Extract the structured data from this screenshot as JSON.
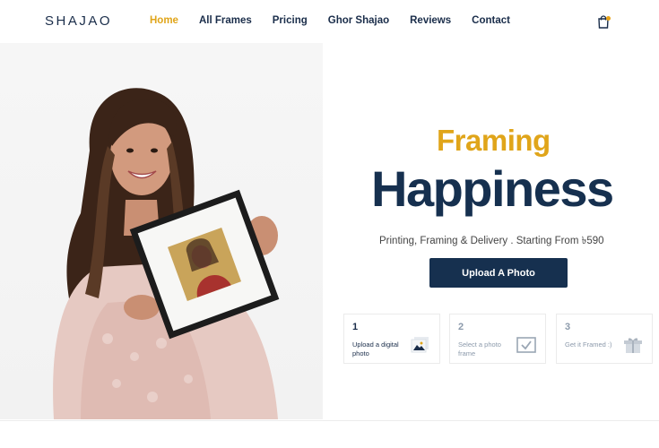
{
  "brand": {
    "logo": "SHAJAO"
  },
  "nav": {
    "items": [
      {
        "label": "Home",
        "active": true
      },
      {
        "label": "All Frames",
        "active": false
      },
      {
        "label": "Pricing",
        "active": false
      },
      {
        "label": "Ghor Shajao",
        "active": false
      },
      {
        "label": "Reviews",
        "active": false
      },
      {
        "label": "Contact",
        "active": false
      }
    ],
    "cart_icon": "shopping-bag-icon"
  },
  "hero": {
    "title_accent": "Framing",
    "title_main": "Happiness",
    "subtitle": "Printing, Framing & Delivery . Starting From ৳590",
    "cta_label": "Upload A Photo",
    "image": "woman-holding-framed-photo"
  },
  "steps": [
    {
      "number": "1",
      "text": "Upload a digital photo",
      "icon": "photo-upload-icon"
    },
    {
      "number": "2",
      "text": "Select a photo frame",
      "icon": "frame-check-icon"
    },
    {
      "number": "3",
      "text": "Get it Framed :)",
      "icon": "gift-box-icon"
    }
  ],
  "colors": {
    "accent": "#e0a51a",
    "navy": "#16304f",
    "muted": "#8c9aab"
  }
}
